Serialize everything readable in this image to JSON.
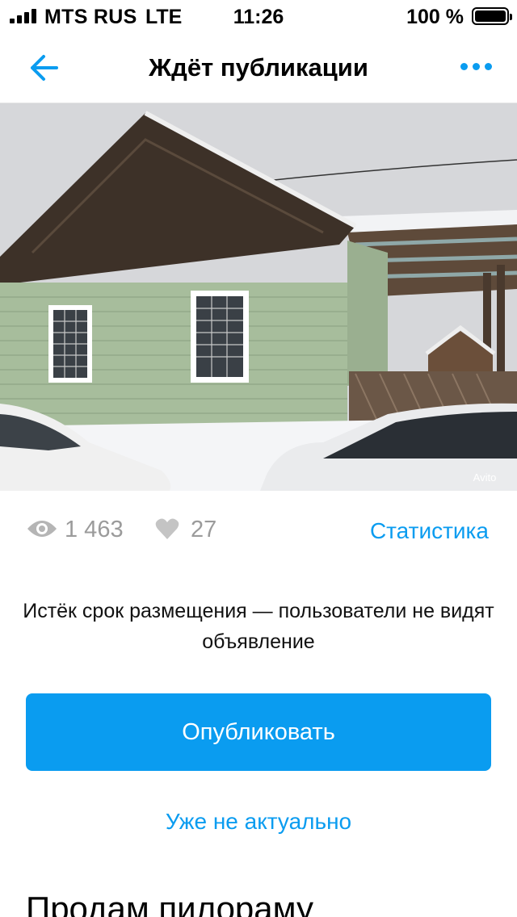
{
  "status_bar": {
    "carrier": "MTS RUS",
    "network": "LTE",
    "time": "11:26",
    "battery_percent": "100 %"
  },
  "nav": {
    "title": "Ждёт публикации",
    "back_icon": "arrow-left-icon",
    "more_icon": "more-horizontal-icon",
    "accent_color": "#0a9cf0"
  },
  "photo": {
    "watermark": "Avito"
  },
  "stats": {
    "views": "1 463",
    "likes": "27",
    "statistics_link": "Статистика"
  },
  "notice": {
    "text": "Истёк срок размещения — пользователи не видят объявление"
  },
  "actions": {
    "publish_label": "Опубликовать",
    "not_actual_label": "Уже не актуально"
  },
  "listing": {
    "title": "Продам пилораму"
  }
}
